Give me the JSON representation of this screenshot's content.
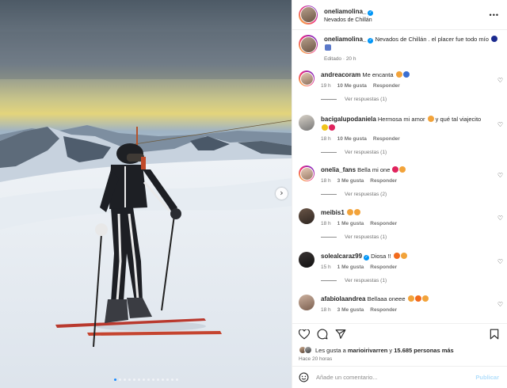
{
  "post": {
    "username": "oneliamolina_",
    "location": "Nevados de Chillán",
    "caption_text": "Nevados de Chillán . el placer fue todo mío",
    "caption_meta": "Editado · 20 h"
  },
  "comments": [
    {
      "user": "andreacoram",
      "text": "Me encanta",
      "time": "19 h",
      "likes": "10 Me gusta",
      "reply": "Responder",
      "replies": "Ver respuestas (1)"
    },
    {
      "user": "bacigalupodaniela",
      "text": "Hermosa mi amor",
      "text2": "y qué tal viajecito",
      "time": "18 h",
      "likes": "10 Me gusta",
      "reply": "Responder",
      "replies": "Ver respuestas (1)"
    },
    {
      "user": "onelia_fans",
      "text": "Bella mi one",
      "time": "18 h",
      "likes": "3 Me gusta",
      "reply": "Responder",
      "replies": "Ver respuestas (2)"
    },
    {
      "user": "meibis1",
      "text": "",
      "time": "18 h",
      "likes": "1 Me gusta",
      "reply": "Responder",
      "replies": "Ver respuestas (1)"
    },
    {
      "user": "solealcaraz99",
      "text": "Diosa !!",
      "time": "15 h",
      "likes": "1 Me gusta",
      "reply": "Responder",
      "replies": "Ver respuestas (1)"
    },
    {
      "user": "afabiolaandrea",
      "text": "Bellaaa oneee",
      "time": "18 h",
      "likes": "3 Me gusta",
      "reply": "Responder"
    }
  ],
  "likes_bar": {
    "prefix": "Les gusta a",
    "user": "marioirivarren",
    "joiner": "y",
    "others": "15.685 personas más",
    "time": "Hace 20 horas"
  },
  "composer": {
    "placeholder": "Añade un comentario...",
    "publish": "Publicar"
  },
  "icons": [
    "heart-icon",
    "comment-icon",
    "share-icon",
    "bookmark-icon",
    "emoji-icon",
    "more-icon",
    "verified-icon",
    "chevron-right-icon"
  ],
  "carousel": {
    "total_dots": 14,
    "active_index": 0
  },
  "colors": {
    "verified": "#0095f6",
    "link_disabled": "#b2dffc",
    "muted": "#737373",
    "carousel_active": "#1a8cff"
  }
}
